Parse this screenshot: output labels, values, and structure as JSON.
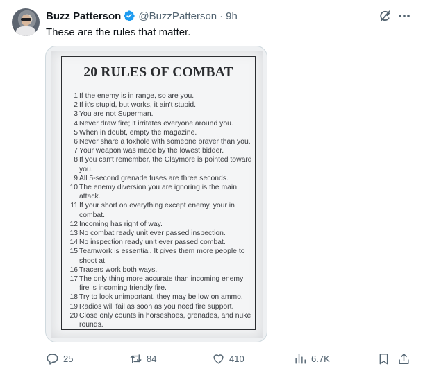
{
  "author": {
    "display_name": "Buzz Patterson",
    "handle": "@BuzzPatterson",
    "separator": "·",
    "time": "9h"
  },
  "tweet": {
    "text": "These are the rules that matter."
  },
  "image": {
    "title": "20 RULES OF COMBAT",
    "rules": [
      {
        "num": "1",
        "text": "If the enemy is in range, so are you."
      },
      {
        "num": "2",
        "text": "If it's stupid, but works, it ain't stupid."
      },
      {
        "num": "3",
        "text": "You are not Superman."
      },
      {
        "num": "4",
        "text": "Never draw fire; it irritates everyone around you."
      },
      {
        "num": "5",
        "text": "When in doubt, empty the magazine."
      },
      {
        "num": "6",
        "text": "Never share a foxhole with someone braver than you."
      },
      {
        "num": "7",
        "text": "Your weapon was made by the lowest bidder."
      },
      {
        "num": "8",
        "text": "If you can't remember, the Claymore is pointed toward you."
      },
      {
        "num": "9",
        "text": "All 5-second grenade fuses are three seconds."
      },
      {
        "num": "10",
        "text": "The enemy diversion you are ignoring is the main attack."
      },
      {
        "num": "11",
        "text": "If your short on everything except enemy, your in combat."
      },
      {
        "num": "12",
        "text": "Incoming has right of way."
      },
      {
        "num": "13",
        "text": "No combat ready unit ever passed inspection."
      },
      {
        "num": "14",
        "text": "No inspection ready unit ever passed combat."
      },
      {
        "num": "15",
        "text": "Teamwork is essential.  It gives them more people to shoot at."
      },
      {
        "num": "16",
        "text": "Tracers work both ways."
      },
      {
        "num": "17",
        "text": "The only thing more accurate than incoming enemy fire is incoming friendly fire."
      },
      {
        "num": "18",
        "text": "Try to look unimportant, they may be low on ammo."
      },
      {
        "num": "19",
        "text": "Radios will fail as soon as you need fire support."
      },
      {
        "num": "20",
        "text": "Close only counts in horseshoes, grenades, and nuke rounds."
      }
    ]
  },
  "actions": {
    "replies": "25",
    "reposts": "84",
    "likes": "410",
    "views": "6.7K"
  },
  "icons": {
    "verified": "verified-badge-icon",
    "grok": "grok-icon",
    "more": "more-icon",
    "reply": "reply-icon",
    "repost": "repost-icon",
    "like": "heart-icon",
    "views": "views-icon",
    "bookmark": "bookmark-icon",
    "share": "share-icon"
  },
  "colors": {
    "verified": "#1d9bf0",
    "secondary_text": "#536471",
    "primary_text": "#0f1419"
  }
}
